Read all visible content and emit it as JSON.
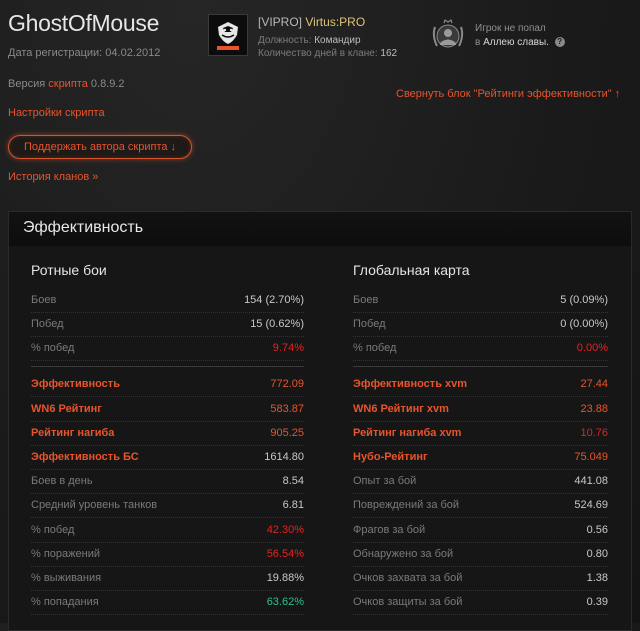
{
  "player": {
    "name": "GhostOfMouse",
    "reg_label": "Дата регистрации:",
    "reg_date": "04.02.2012"
  },
  "script": {
    "version_prefix": "Версия",
    "version_link": "скрипта",
    "version_number": "0.8.9.2",
    "settings_label": "Настройки скрипта",
    "support_label": "Поддержать автора скрипта ↓",
    "history_label": "История кланов »",
    "collapse_label": "Свернуть блок \"Рейтинги эффективности\" ↑"
  },
  "clan": {
    "tag": "[VIPRO]",
    "name": "Virtus:PRO",
    "position_label": "Должность:",
    "position_value": "Командир",
    "days_label": "Количество дней в клане:",
    "days_value": "162"
  },
  "fame": {
    "line1": "Игрок не попал",
    "line2_prefix": "в",
    "line2_link": "Аллею славы."
  },
  "panel": {
    "title": "Эффективность"
  },
  "company": {
    "title": "Ротные бои",
    "rows": [
      {
        "label": "Боев",
        "value": "154 (2.70%)"
      },
      {
        "label": "Побед",
        "value": "15 (0.62%)"
      },
      {
        "label": "% побед",
        "value": "9.74%"
      },
      {
        "label": "Эффективность",
        "value": "772.09"
      },
      {
        "label": "WN6 Рейтинг",
        "value": "583.87"
      },
      {
        "label": "Рейтинг нагиба",
        "value": "905.25"
      },
      {
        "label": "Эффективность БС",
        "value": "1614.80"
      },
      {
        "label": "Боев в день",
        "value": "8.54"
      },
      {
        "label": "Средний уровень танков",
        "value": "6.81"
      },
      {
        "label": "% побед",
        "value": "42.30%"
      },
      {
        "label": "% поражений",
        "value": "56.54%"
      },
      {
        "label": "% выживания",
        "value": "19.88%"
      },
      {
        "label": "% попадания",
        "value": "63.62%"
      }
    ]
  },
  "global": {
    "title": "Глобальная карта",
    "rows": [
      {
        "label": "Боев",
        "value": "5 (0.09%)"
      },
      {
        "label": "Побед",
        "value": "0 (0.00%)"
      },
      {
        "label": "% побед",
        "value": "0.00%"
      },
      {
        "label": "Эффективность xvm",
        "value": "27.44"
      },
      {
        "label": "WN6 Рейтинг xvm",
        "value": "23.88"
      },
      {
        "label": "Рейтинг нагиба xvm",
        "value": "10.76"
      },
      {
        "label": "Нубо-Рейтинг",
        "value": "75.049"
      },
      {
        "label": "Опыт за бой",
        "value": "441.08"
      },
      {
        "label": "Повреждений за бой",
        "value": "524.69"
      },
      {
        "label": "Фрагов за бой",
        "value": "0.56"
      },
      {
        "label": "Обнаружено за бой",
        "value": "0.80"
      },
      {
        "label": "Очков захвата за бой",
        "value": "1.38"
      },
      {
        "label": "Очков защиты за бой",
        "value": "0.39"
      }
    ]
  },
  "colors": {
    "accent": "#e8542b",
    "negative": "#e02424",
    "positive": "#2fc08a",
    "clan_name": "#e0c27a"
  }
}
